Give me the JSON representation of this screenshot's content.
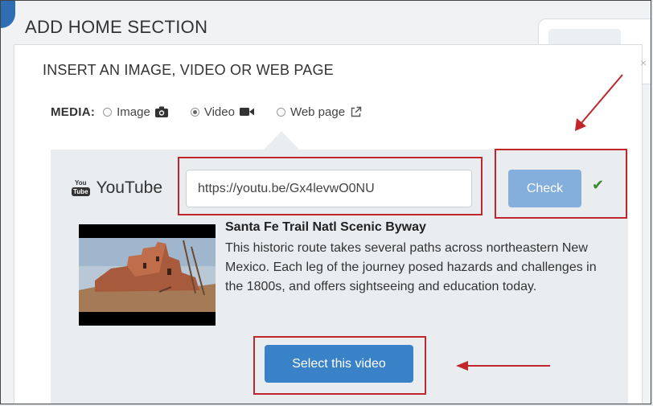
{
  "page": {
    "title": "ADD HOME SECTION"
  },
  "modal": {
    "title": "INSERT AN IMAGE, VIDEO OR WEB PAGE",
    "close": "×",
    "media": {
      "label": "MEDIA:",
      "options": [
        {
          "label": "Image",
          "icon": "camera-icon",
          "selected": false
        },
        {
          "label": "Video",
          "icon": "video-camera-icon",
          "selected": true
        },
        {
          "label": "Web page",
          "icon": "external-link-icon",
          "selected": false
        }
      ]
    },
    "youtube": {
      "label": "YouTube",
      "icon_top": "You",
      "icon_bottom": "Tube",
      "url_value": "https://youtu.be/Gx4levwO0NU",
      "check_label": "Check",
      "check_status": "✔"
    },
    "video": {
      "title": "Santa Fe Trail Natl Scenic Byway",
      "description": "This historic route takes several paths across northeastern New Mexico. Each leg of the journey posed hazards and challenges in the 1800s, and offers sightseeing and education today.",
      "select_label": "Select this video"
    }
  },
  "colors": {
    "highlight": "#c0262c",
    "primary_button": "#3a82c8",
    "check_button": "#84aedc",
    "success": "#3c8a2e"
  }
}
